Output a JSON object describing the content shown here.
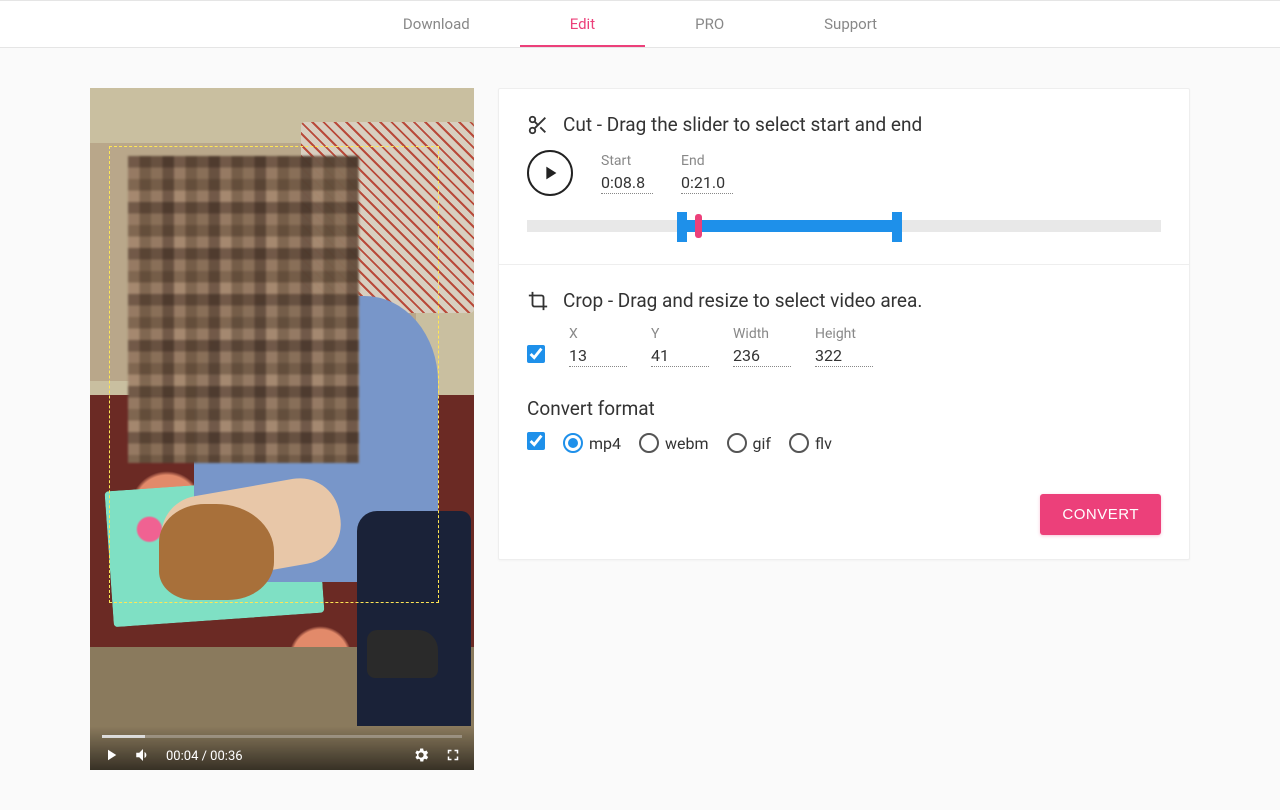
{
  "nav": {
    "download": "Download",
    "edit": "Edit",
    "pro": "PRO",
    "support": "Support"
  },
  "cut": {
    "title": "Cut - Drag the slider to select start and end",
    "start_label": "Start",
    "end_label": "End",
    "start_value": "0:08.8",
    "end_value": "0:21.0",
    "range_start_pct": 24.4,
    "range_end_pct": 58.3,
    "playhead_pct": 27.0
  },
  "crop": {
    "title": "Crop - Drag and resize to select video area.",
    "enabled": true,
    "x_label": "X",
    "y_label": "Y",
    "w_label": "Width",
    "h_label": "Height",
    "x": "13",
    "y": "41",
    "width": "236",
    "height": "322"
  },
  "format": {
    "title": "Convert format",
    "enabled": true,
    "selected": "mp4",
    "options": [
      "mp4",
      "webm",
      "gif",
      "flv"
    ]
  },
  "convert_label": "CONVERT",
  "player": {
    "time": "00:04 / 00:36",
    "crop_overlay": {
      "left_pct": 5,
      "top_pct": 8.5,
      "width_pct": 86,
      "height_pct": 67
    }
  }
}
